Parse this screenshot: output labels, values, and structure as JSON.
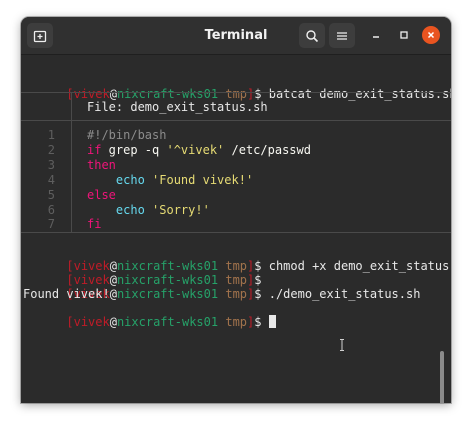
{
  "window": {
    "title": "Terminal",
    "accent_close": "#e95420",
    "icons": [
      "new-tab-icon",
      "search-icon",
      "hamburger-menu-icon",
      "minimize-icon",
      "maximize-icon",
      "close-icon"
    ]
  },
  "prompt": {
    "open": "[",
    "user": "vivek",
    "at": "@",
    "host": "nixcraft-wks01",
    "dir": "tmp",
    "close": "]",
    "symbol": "$"
  },
  "commands": {
    "c1": " batcat demo_exit_status.sh",
    "c2": " chmod +x demo_exit_status.sh",
    "c3": "",
    "c4": " ./demo_exit_status.sh",
    "c5": " "
  },
  "bat": {
    "file_label": "File: demo_exit_status.sh",
    "line_numbers": [
      "1",
      "2",
      "3",
      "4",
      "5",
      "6",
      "7"
    ],
    "code": {
      "l1": "#!/bin/bash",
      "l2_kw": "if",
      "l2_cmd": " grep -q ",
      "l2_str": "'^vivek'",
      "l2_rest": " /etc/passwd",
      "l3": "then",
      "l4_fn": "    echo ",
      "l4_str": "'Found vivek!'",
      "l5": "else",
      "l6_fn": "    echo ",
      "l6_str": "'Sorry!'",
      "l7": "fi"
    }
  },
  "output": {
    "found": "Found vivek!"
  },
  "colors": {
    "prompt_user": "#c01c28",
    "prompt_host": "#26a269",
    "prompt_dir": "#a2734c",
    "keyword": "#f0147a",
    "string": "#e6db74",
    "builtin": "#66d9ef",
    "comment": "#8c8c8c"
  }
}
